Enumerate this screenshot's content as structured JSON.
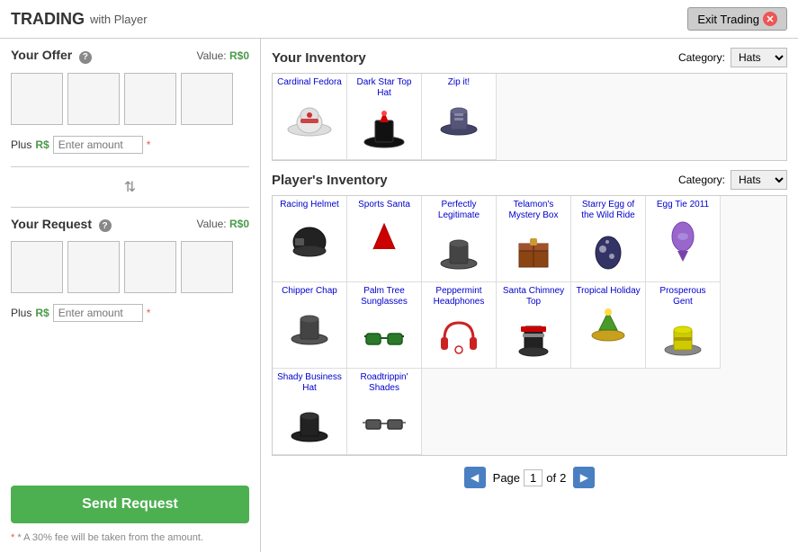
{
  "header": {
    "title": "TRADING",
    "with_label": "with Player",
    "exit_label": "Exit Trading"
  },
  "left_panel": {
    "your_offer": {
      "title": "Your Offer",
      "help": "?",
      "value_label": "Value:",
      "value": "R$0"
    },
    "your_request": {
      "title": "Your Request",
      "help": "?",
      "value_label": "Value:",
      "value": "R$0"
    },
    "plus_label": "Plus",
    "rs_label": "R$",
    "amount_placeholder": "Enter amount",
    "send_button": "Send Request",
    "fee_note": "* A 30% fee will be taken from the amount."
  },
  "your_inventory": {
    "title": "Your Inventory",
    "category_label": "Category:",
    "category_value": "Hats",
    "items": [
      {
        "name": "Cardinal Fedora",
        "emoji": "🎩",
        "color": "#eee"
      },
      {
        "name": "Dark Star Top Hat",
        "emoji": "🎩",
        "color": "#111"
      },
      {
        "name": "Zip it!",
        "emoji": "🎩",
        "color": "#336"
      }
    ]
  },
  "player_inventory": {
    "title": "Player's Inventory",
    "category_label": "Category:",
    "category_value": "Hats",
    "items": [
      {
        "name": "Racing Helmet",
        "emoji": "🪖",
        "color": "#222"
      },
      {
        "name": "Sports Santa",
        "emoji": "🎅",
        "color": "#c00"
      },
      {
        "name": "Perfectly Legitimate",
        "emoji": "🎩",
        "color": "#333"
      },
      {
        "name": "Telamon's Mystery Box",
        "emoji": "📦",
        "color": "#8B4513"
      },
      {
        "name": "Starry Egg of the Wild Ride",
        "emoji": "🥚",
        "color": "#446"
      },
      {
        "name": "Egg Tie 2011",
        "emoji": "🥚",
        "color": "#9966cc"
      },
      {
        "name": "Chipper Chap",
        "emoji": "🎩",
        "color": "#111"
      },
      {
        "name": "Palm Tree Sunglasses",
        "emoji": "🕶️",
        "color": "#4a4"
      },
      {
        "name": "Peppermint Headphones",
        "emoji": "🎧",
        "color": "#e33"
      },
      {
        "name": "Santa Chimney Top",
        "emoji": "🎅",
        "color": "#333"
      },
      {
        "name": "Tropical Holiday",
        "emoji": "🌴",
        "color": "#4a4"
      },
      {
        "name": "Prosperous Gent",
        "emoji": "🎩",
        "color": "#cc0"
      },
      {
        "name": "Shady Business Hat",
        "emoji": "🎩",
        "color": "#222"
      },
      {
        "name": "Roadtrippin' Shades",
        "emoji": "🕶️",
        "color": "#555"
      }
    ],
    "page_current": "1",
    "page_total": "2",
    "page_label": "Page",
    "of_label": "of"
  }
}
